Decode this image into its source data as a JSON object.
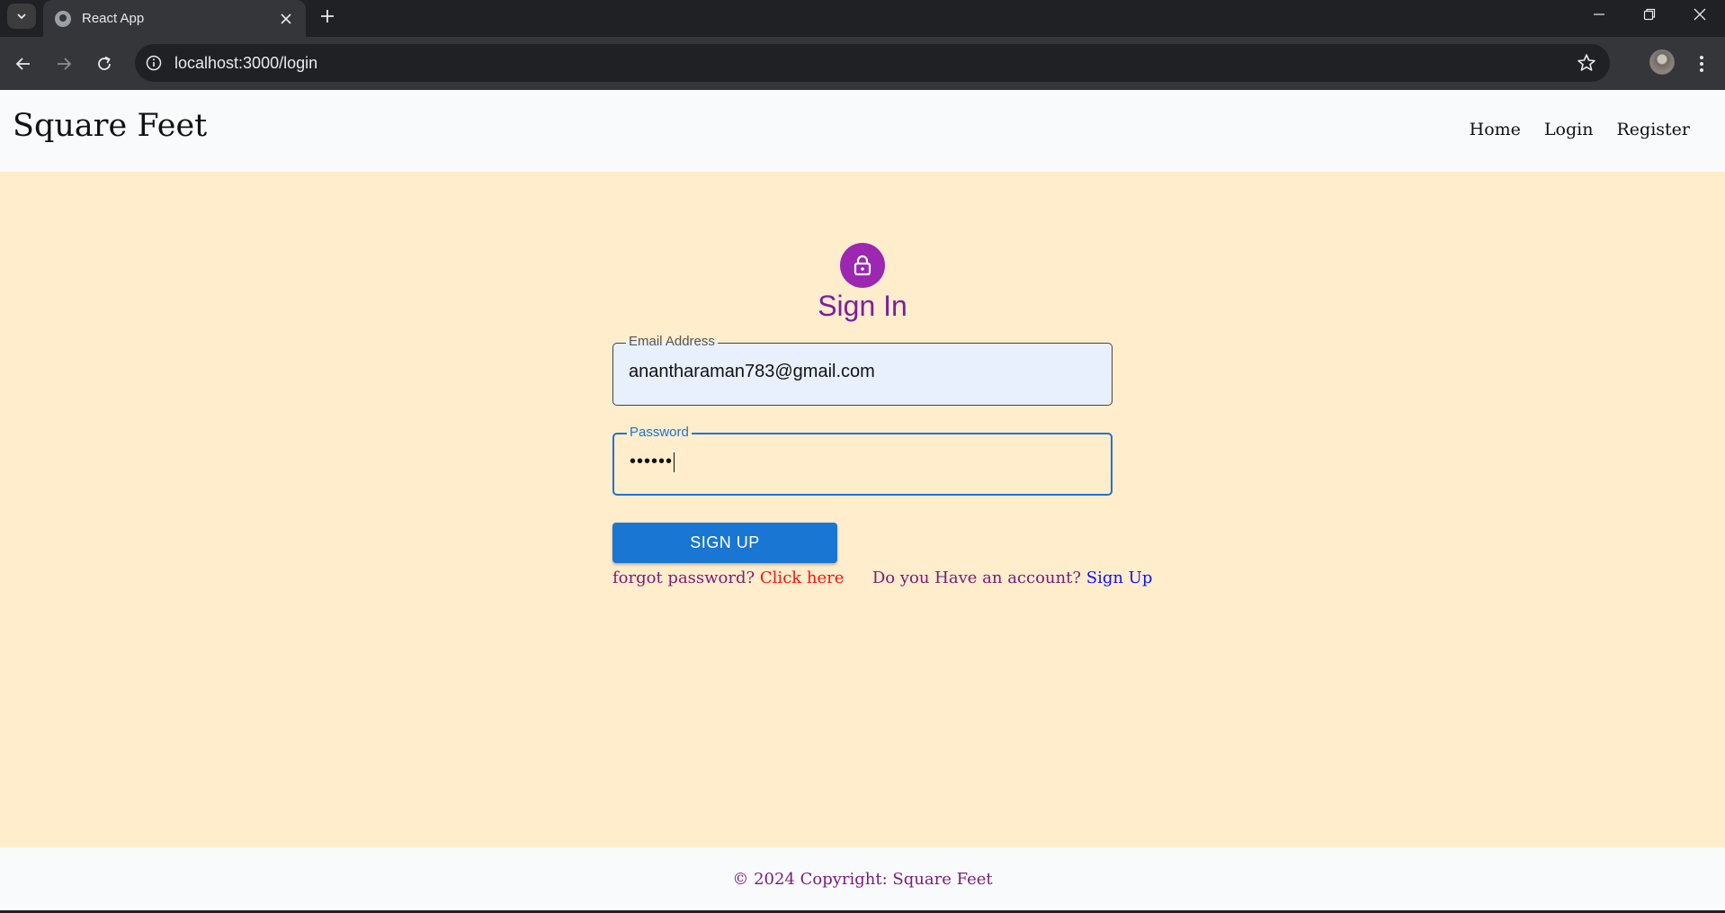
{
  "browser": {
    "tab_title": "React App",
    "url": "localhost:3000/login"
  },
  "header": {
    "brand": "Square Feet",
    "nav": [
      {
        "label": "Home"
      },
      {
        "label": "Login"
      },
      {
        "label": "Register"
      }
    ]
  },
  "form": {
    "heading": "Sign In",
    "email_label": "Email Address",
    "email_value": "anantharaman783@gmail.com",
    "password_label": "Password",
    "password_value": "••••••",
    "submit_label": "SIGN UP",
    "forgot_text": "forgot password?",
    "forgot_link": "Click here",
    "account_text": "Do you Have an account?",
    "account_link": "Sign Up"
  },
  "footer": {
    "text": "© 2024 Copyright: Square Feet"
  },
  "colors": {
    "page_bg": "#ffedcc",
    "header_bg": "#f9fafc",
    "accent_purple": "#9c27b0",
    "primary_blue": "#1976d2",
    "link_red": "#ff1010",
    "link_blue": "#1010ff"
  },
  "icons": {
    "avatar": "lock-icon",
    "tab_favicon": "globe-icon"
  }
}
